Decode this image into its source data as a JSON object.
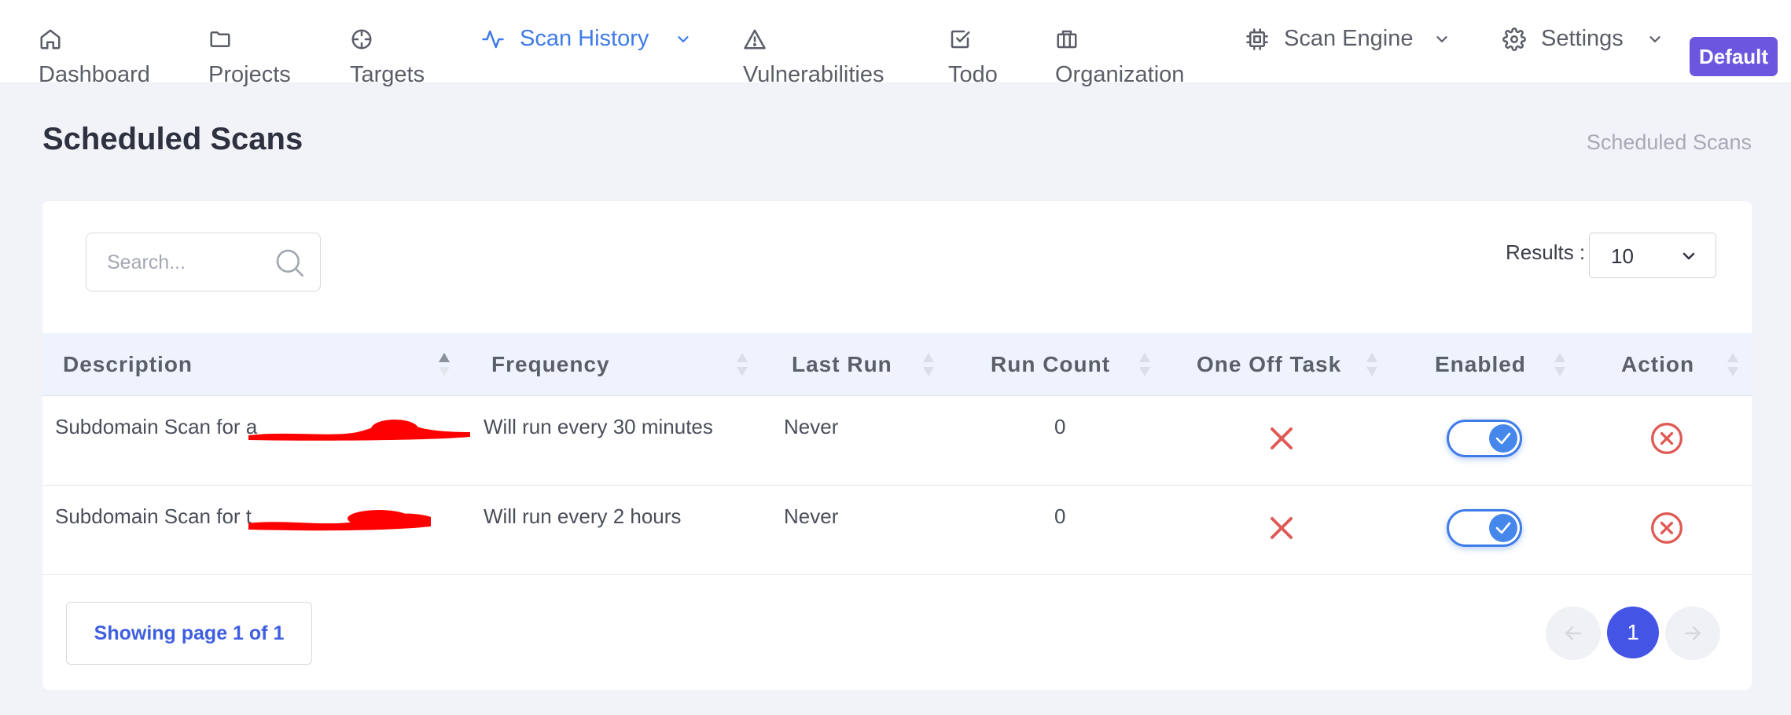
{
  "nav": {
    "dashboard": "Dashboard",
    "projects": "Projects",
    "targets": "Targets",
    "scan_history": "Scan History",
    "vulnerabilities": "Vulnerabilities",
    "todo": "Todo",
    "organization": "Organization",
    "scan_engine": "Scan Engine",
    "settings": "Settings",
    "badge": "Default"
  },
  "page": {
    "title": "Scheduled Scans",
    "breadcrumb": "Scheduled Scans"
  },
  "search": {
    "placeholder": "Search..."
  },
  "results": {
    "label": "Results :",
    "value": "10"
  },
  "table": {
    "headers": {
      "description": "Description",
      "frequency": "Frequency",
      "last_run": "Last Run",
      "run_count": "Run Count",
      "one_off": "One Off Task",
      "enabled": "Enabled",
      "action": "Action"
    },
    "rows": [
      {
        "description": "Subdomain Scan for a",
        "frequency": "Will run every 30 minutes",
        "last_run": "Never",
        "run_count": "0",
        "one_off": false,
        "enabled": true
      },
      {
        "description": "Subdomain Scan for t",
        "frequency": "Will run every 2 hours",
        "last_run": "Never",
        "run_count": "0",
        "one_off": false,
        "enabled": true
      }
    ]
  },
  "pagination": {
    "info": "Showing page 1 of 1",
    "current": "1"
  },
  "colors": {
    "accent": "#3f7ce8",
    "badge": "#6c56e0",
    "danger": "#e05a55",
    "page_active": "#4455e5"
  }
}
